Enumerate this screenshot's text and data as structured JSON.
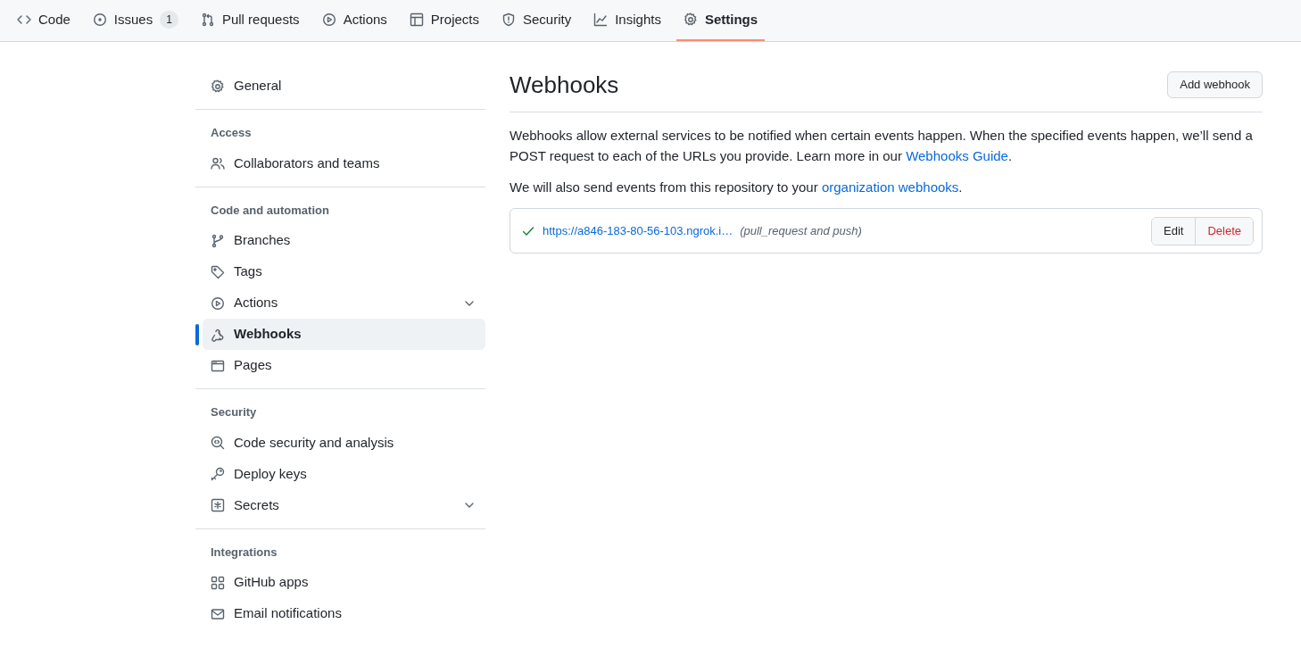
{
  "nav_tabs": [
    {
      "label": "Code",
      "selected": false
    },
    {
      "label": "Issues",
      "counter": "1",
      "selected": false
    },
    {
      "label": "Pull requests",
      "selected": false
    },
    {
      "label": "Actions",
      "selected": false
    },
    {
      "label": "Projects",
      "selected": false
    },
    {
      "label": "Security",
      "selected": false
    },
    {
      "label": "Insights",
      "selected": false
    },
    {
      "label": "Settings",
      "selected": true
    }
  ],
  "sidebar": {
    "sections": [
      {
        "items": [
          {
            "label": "General",
            "selected": false,
            "expandable": false
          }
        ]
      },
      {
        "heading": "Access",
        "items": [
          {
            "label": "Collaborators and teams",
            "selected": false,
            "expandable": false
          }
        ]
      },
      {
        "heading": "Code and automation",
        "items": [
          {
            "label": "Branches",
            "selected": false,
            "expandable": false
          },
          {
            "label": "Tags",
            "selected": false,
            "expandable": false
          },
          {
            "label": "Actions",
            "selected": false,
            "expandable": true
          },
          {
            "label": "Webhooks",
            "selected": true,
            "expandable": false
          },
          {
            "label": "Pages",
            "selected": false,
            "expandable": false
          }
        ]
      },
      {
        "heading": "Security",
        "items": [
          {
            "label": "Code security and analysis",
            "selected": false,
            "expandable": false
          },
          {
            "label": "Deploy keys",
            "selected": false,
            "expandable": false
          },
          {
            "label": "Secrets",
            "selected": false,
            "expandable": true
          }
        ]
      },
      {
        "heading": "Integrations",
        "items": [
          {
            "label": "GitHub apps",
            "selected": false,
            "expandable": false
          },
          {
            "label": "Email notifications",
            "selected": false,
            "expandable": false
          }
        ]
      }
    ]
  },
  "main": {
    "title": "Webhooks",
    "add_button": "Add webhook",
    "description": [
      "Webhooks allow external services to be notified when certain events happen. When the specified events happen, we’ll send a POST request to each of the URLs you provide. Learn more in our ",
      {
        "link": "Webhooks Guide"
      },
      "."
    ],
    "note": [
      "We will also send events from this repository to your ",
      {
        "link": "organization webhooks"
      },
      "."
    ],
    "webhooks": [
      {
        "delivered": true,
        "url": "https://a846-183-80-56-103.ngrok.i…",
        "events": "(pull_request and push)",
        "edit": "Edit",
        "delete": "Delete"
      }
    ]
  }
}
